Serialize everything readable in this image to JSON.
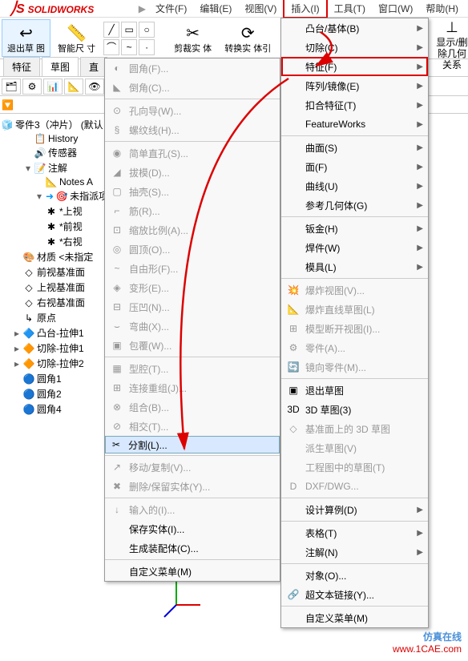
{
  "menubar": {
    "logo": "SOLIDWORKS",
    "items": [
      "文件(F)",
      "编辑(E)",
      "视图(V)",
      "插入(I)",
      "工具(T)",
      "窗口(W)",
      "帮助(H)"
    ]
  },
  "toolbar": {
    "exit_sketch": "退出草\n图",
    "smart_dim": "智能尺\n寸",
    "trim": "剪裁实\n体",
    "convert": "转换实\n体引"
  },
  "right_strip": "显示/删\n除几何\n关系",
  "tabs": [
    "特征",
    "草图",
    "直"
  ],
  "tree": {
    "root": "零件3（冲片）",
    "root_suffix": "(默认",
    "items": [
      {
        "icon": "📋",
        "label": "History"
      },
      {
        "icon": "🔊",
        "label": "传感器"
      },
      {
        "icon": "📝",
        "label": "注解",
        "expand": "-"
      },
      {
        "icon": "📐",
        "label": "Notes A",
        "indent": 3
      },
      {
        "icon": "🎯",
        "label": "未指派项",
        "indent": 3,
        "expand": "-",
        "arrow": true
      },
      {
        "icon": "✱",
        "label": "*上视",
        "indent": 3
      },
      {
        "icon": "✱",
        "label": "*前视",
        "indent": 3
      },
      {
        "icon": "✱",
        "label": "*右视",
        "indent": 3
      },
      {
        "icon": "🎨",
        "label": "材质 <未指定",
        "indent": 1
      },
      {
        "icon": "◇",
        "label": "前视基准面",
        "indent": 1
      },
      {
        "icon": "◇",
        "label": "上视基准面",
        "indent": 1
      },
      {
        "icon": "◇",
        "label": "右视基准面",
        "indent": 1
      },
      {
        "icon": "↳",
        "label": "原点",
        "indent": 1
      },
      {
        "icon": "🔷",
        "label": "凸台-拉伸1",
        "indent": 1,
        "expand": "+"
      },
      {
        "icon": "🔶",
        "label": "切除-拉伸1",
        "indent": 1,
        "expand": "+"
      },
      {
        "icon": "🔶",
        "label": "切除-拉伸2",
        "indent": 1,
        "expand": "+"
      },
      {
        "icon": "🔵",
        "label": "圆角1",
        "indent": 1
      },
      {
        "icon": "🔵",
        "label": "圆角2",
        "indent": 1
      },
      {
        "icon": "🔵",
        "label": "圆角4",
        "indent": 1
      }
    ]
  },
  "dropdown1": [
    {
      "icon": "◐",
      "label": "圆角(F)...",
      "dis": true
    },
    {
      "icon": "◣",
      "label": "倒角(C)...",
      "dis": true
    },
    {
      "sep": true
    },
    {
      "icon": "⊙",
      "label": "孔向导(W)...",
      "dis": true
    },
    {
      "icon": "§",
      "label": "螺纹线(H)...",
      "dis": true
    },
    {
      "sep": true
    },
    {
      "icon": "◉",
      "label": "简单直孔(S)...",
      "dis": true
    },
    {
      "icon": "◢",
      "label": "拔模(D)...",
      "dis": true
    },
    {
      "icon": "▢",
      "label": "抽壳(S)...",
      "dis": true
    },
    {
      "icon": "⌐",
      "label": "筋(R)...",
      "dis": true
    },
    {
      "icon": "⊡",
      "label": "缩放比例(A)...",
      "dis": true
    },
    {
      "icon": "◎",
      "label": "圆顶(O)...",
      "dis": true
    },
    {
      "icon": "~",
      "label": "自由形(F)...",
      "dis": true
    },
    {
      "icon": "◈",
      "label": "变形(E)...",
      "dis": true
    },
    {
      "icon": "⊟",
      "label": "压凹(N)...",
      "dis": true
    },
    {
      "icon": "⌣",
      "label": "弯曲(X)...",
      "dis": true
    },
    {
      "icon": "▣",
      "label": "包覆(W)...",
      "dis": true
    },
    {
      "sep": true
    },
    {
      "icon": "▦",
      "label": "型腔(T)...",
      "dis": true
    },
    {
      "icon": "⊞",
      "label": "连接重组(J)...",
      "dis": true
    },
    {
      "icon": "⊗",
      "label": "组合(B)...",
      "dis": true
    },
    {
      "icon": "⊘",
      "label": "相交(T)...",
      "dis": true
    },
    {
      "icon": "✂",
      "label": "分割(L)...",
      "hl": true,
      "sel": true
    },
    {
      "sep": true
    },
    {
      "icon": "↗",
      "label": "移动/复制(V)...",
      "dis": true
    },
    {
      "icon": "✖",
      "label": "删除/保留实体(Y)...",
      "dis": true
    },
    {
      "sep": true
    },
    {
      "icon": "↓",
      "label": "输入的(I)...",
      "dis": true
    },
    {
      "label": "保存实体(I)..."
    },
    {
      "label": "生成装配体(C)..."
    },
    {
      "sep": true
    },
    {
      "label": "自定义菜单(M)"
    }
  ],
  "dropdown2": [
    {
      "label": "凸台/基体(B)",
      "arrow": true
    },
    {
      "label": "切除(C)",
      "arrow": true
    },
    {
      "label": "特征(F)",
      "arrow": true,
      "hl": true
    },
    {
      "label": "阵列/镜像(E)",
      "arrow": true
    },
    {
      "label": "扣合特征(T)",
      "arrow": true
    },
    {
      "label": "FeatureWorks",
      "arrow": true
    },
    {
      "sep": true
    },
    {
      "label": "曲面(S)",
      "arrow": true
    },
    {
      "label": "面(F)",
      "arrow": true
    },
    {
      "label": "曲线(U)",
      "arrow": true
    },
    {
      "label": "参考几何体(G)",
      "arrow": true
    },
    {
      "sep": true
    },
    {
      "label": "钣金(H)",
      "arrow": true
    },
    {
      "label": "焊件(W)",
      "arrow": true
    },
    {
      "label": "模具(L)",
      "arrow": true
    },
    {
      "sep": true
    },
    {
      "icon": "💥",
      "label": "爆炸视图(V)...",
      "dis": true
    },
    {
      "icon": "📐",
      "label": "爆炸直线草图(L)",
      "dis": true
    },
    {
      "icon": "⊞",
      "label": "模型断开视图(I)...",
      "dis": true
    },
    {
      "icon": "⚙",
      "label": "零件(A)...",
      "dis": true
    },
    {
      "icon": "🔄",
      "label": "镜向零件(M)...",
      "dis": true
    },
    {
      "sep": true
    },
    {
      "icon": "▣",
      "label": "退出草图"
    },
    {
      "icon": "3D",
      "label": "3D 草图(3)"
    },
    {
      "icon": "◇",
      "label": "基准面上的 3D 草图",
      "dis": true
    },
    {
      "label": "派生草图(V)",
      "dis": true
    },
    {
      "label": "工程图中的草图(T)",
      "dis": true
    },
    {
      "icon": "D",
      "label": "DXF/DWG...",
      "dis": true
    },
    {
      "sep": true
    },
    {
      "label": "设计算例(D)",
      "arrow": true
    },
    {
      "sep": true
    },
    {
      "label": "表格(T)",
      "arrow": true
    },
    {
      "label": "注解(N)",
      "arrow": true
    },
    {
      "sep": true
    },
    {
      "label": "对象(O)..."
    },
    {
      "icon": "🔗",
      "label": "超文本链接(Y)..."
    },
    {
      "sep": true
    },
    {
      "label": "自定义菜单(M)"
    }
  ],
  "watermark": {
    "line1": "仿真在线",
    "line2": "www.1CAE.com"
  }
}
